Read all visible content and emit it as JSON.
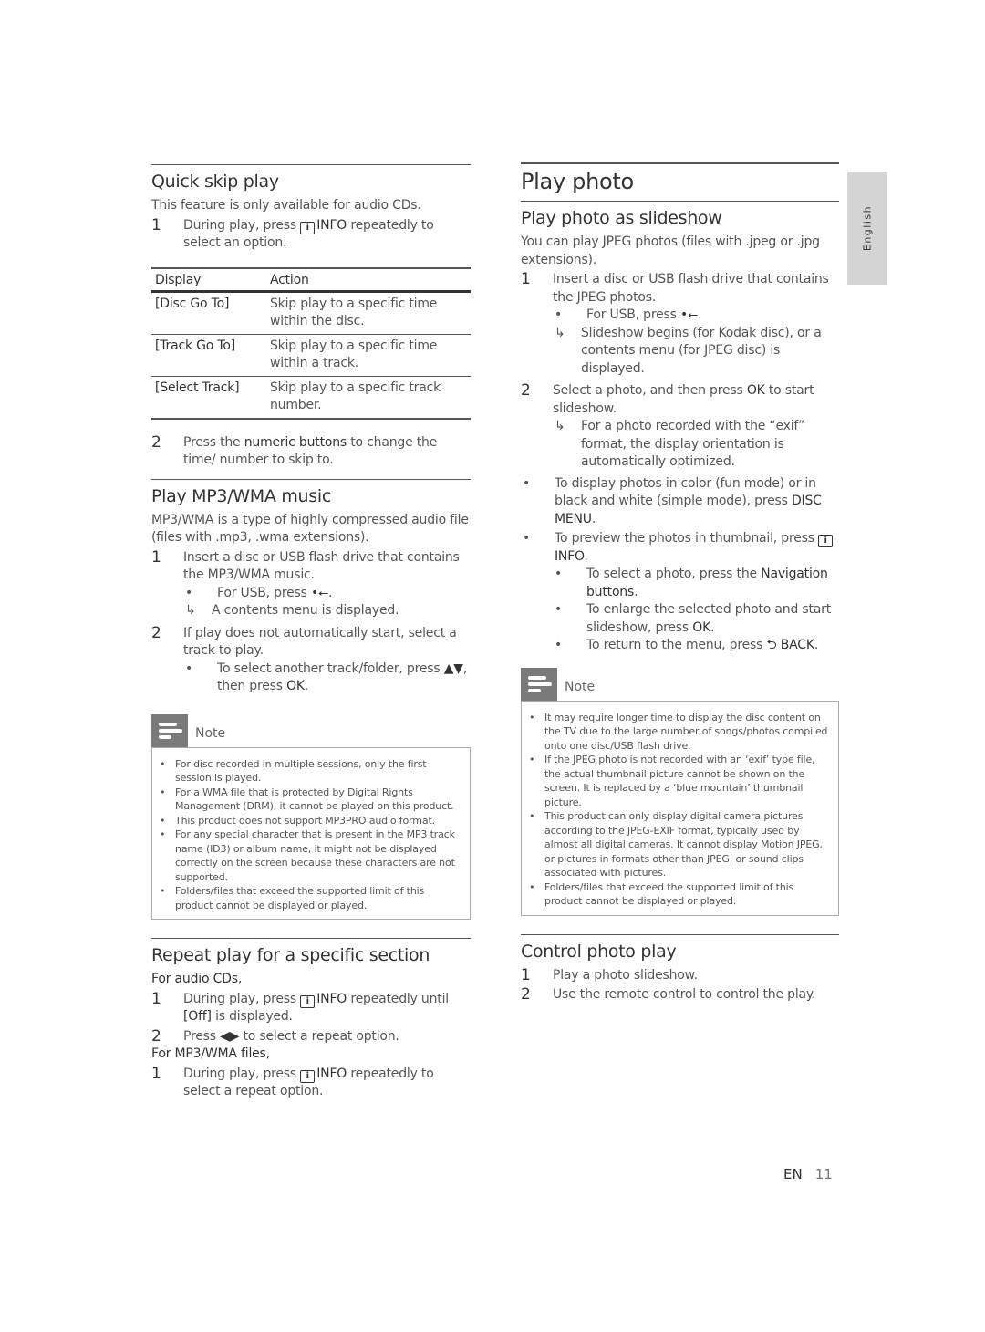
{
  "side_tab": {
    "label": "English"
  },
  "footer": {
    "lang": "EN",
    "page": "11"
  },
  "left": {
    "quick_skip": {
      "title": "Quick skip play",
      "intro": "This feature is only available for audio CDs.",
      "step1": {
        "num": "1",
        "pre": "During play, press ",
        "icon": "i",
        "btn": "INFO",
        "post": " repeatedly to select an option."
      },
      "table": {
        "headers": [
          "Display",
          "Action"
        ],
        "rows": [
          [
            "[Disc Go To]",
            "Skip play to a specific time within the disc."
          ],
          [
            "[Track Go To]",
            "Skip play to a specific time within a track."
          ],
          [
            "[Select Track]",
            "Skip play to a specific track number."
          ]
        ]
      },
      "step2": {
        "num": "2",
        "pre": "Press the ",
        "btn": "numeric buttons",
        "post": " to change the time/ number to skip to."
      }
    },
    "mp3": {
      "title": "Play MP3/WMA music",
      "intro": "MP3/WMA is a type of highly compressed audio file (files with .mp3, .wma extensions).",
      "step1": {
        "num": "1",
        "text": "Insert a disc or USB flash drive that contains the MP3/WMA music."
      },
      "usb": {
        "bullet": "•",
        "text": "For USB, press ",
        "icon": "⭠"
      },
      "result": {
        "arrow": "↳",
        "text": "A contents menu is displayed."
      },
      "step2": {
        "num": "2",
        "text": "If play does not automatically start, select a track to play."
      },
      "sub": {
        "bullet": "•",
        "pre": "To select another track/folder, press ",
        "keys": "▲▼",
        "mid": ", then press ",
        "btn": "OK",
        "post": "."
      }
    },
    "note": {
      "label": "Note",
      "items": [
        "For disc recorded in multiple sessions, only the first session is played.",
        "For a WMA file that is protected by Digital Rights Management (DRM), it cannot be played on this product.",
        "This product does not support MP3PRO audio format.",
        "For any special character that is present in the MP3 track name (ID3) or album name, it might not be displayed correctly on the screen because these characters are not supported.",
        "Folders/files that exceed the supported limit of this product cannot be displayed or played."
      ]
    },
    "repeat": {
      "title": "Repeat play for a specific section",
      "cd_label": "For audio CDs,",
      "cd_step1": {
        "num": "1",
        "pre": "During play, press ",
        "icon": "i",
        "btn": "INFO",
        "post": " repeatedly until ",
        "val": "[Off]",
        "post2": " is displayed."
      },
      "cd_step2": {
        "num": "2",
        "pre": "Press ",
        "keys": "◀▶",
        "post": " to select a repeat option."
      },
      "mp3_label": "For MP3/WMA files,",
      "mp3_step1": {
        "num": "1",
        "pre": "During play, press ",
        "icon": "i",
        "btn": "INFO",
        "post": " repeatedly to select a repeat option."
      }
    }
  },
  "right": {
    "title": "Play photo",
    "slideshow": {
      "title": "Play photo as slideshow",
      "intro": "You can play JPEG photos (files with .jpeg or .jpg extensions).",
      "step1": {
        "num": "1",
        "text": "Insert a disc or USB flash drive that contains the JPEG photos."
      },
      "usb": {
        "bullet": "•",
        "text": "For USB, press ",
        "icon": "⭠"
      },
      "result1": {
        "arrow": "↳",
        "text": "Slideshow begins (for Kodak disc), or a contents menu (for JPEG disc) is displayed."
      },
      "step2": {
        "num": "2",
        "pre": "Select a photo, and then press ",
        "btn": "OK",
        "post": " to start slideshow."
      },
      "result2": {
        "arrow": "↳",
        "text": "For a photo recorded with the “exif” format, the display orientation is automatically optimized."
      },
      "bullet1": {
        "mk": "•",
        "pre": "To display photos in color (fun mode) or in black and white (simple mode), press ",
        "btn": "DISC MENU",
        "post": "."
      },
      "bullet2": {
        "mk": "•",
        "pre": "To preview the photos in thumbnail, press ",
        "icon": "i",
        "btn": "INFO",
        "post": "."
      },
      "subs": [
        {
          "mk": "•",
          "pre": "To select a photo, press the ",
          "btn": "Navigation buttons",
          "post": "."
        },
        {
          "mk": "•",
          "pre": "To enlarge the selected photo and start slideshow, press ",
          "btn": "OK",
          "post": "."
        },
        {
          "mk": "•",
          "pre": "To return to the menu, press ",
          "icon": "⮌",
          "btn": "BACK",
          "post": "."
        }
      ]
    },
    "note": {
      "label": "Note",
      "items": [
        "It may require longer time to display the disc content on the TV due to the large number of songs/photos compiled onto one disc/USB flash drive.",
        "If the JPEG photo is not recorded with an ‘exif’ type file, the actual thumbnail picture cannot be shown on the screen. It is replaced by a ‘blue mountain’ thumbnail picture.",
        "This product can only display digital camera pictures according to the JPEG-EXIF format, typically used by almost all digital cameras. It cannot display Motion JPEG, or pictures in formats other than JPEG, or sound clips associated with pictures.",
        "Folders/files that exceed the supported limit of this product cannot be displayed or played."
      ]
    },
    "control": {
      "title": "Control photo play",
      "steps": [
        {
          "num": "1",
          "text": "Play a photo slideshow."
        },
        {
          "num": "2",
          "text": "Use the remote control to control the play."
        }
      ]
    }
  }
}
